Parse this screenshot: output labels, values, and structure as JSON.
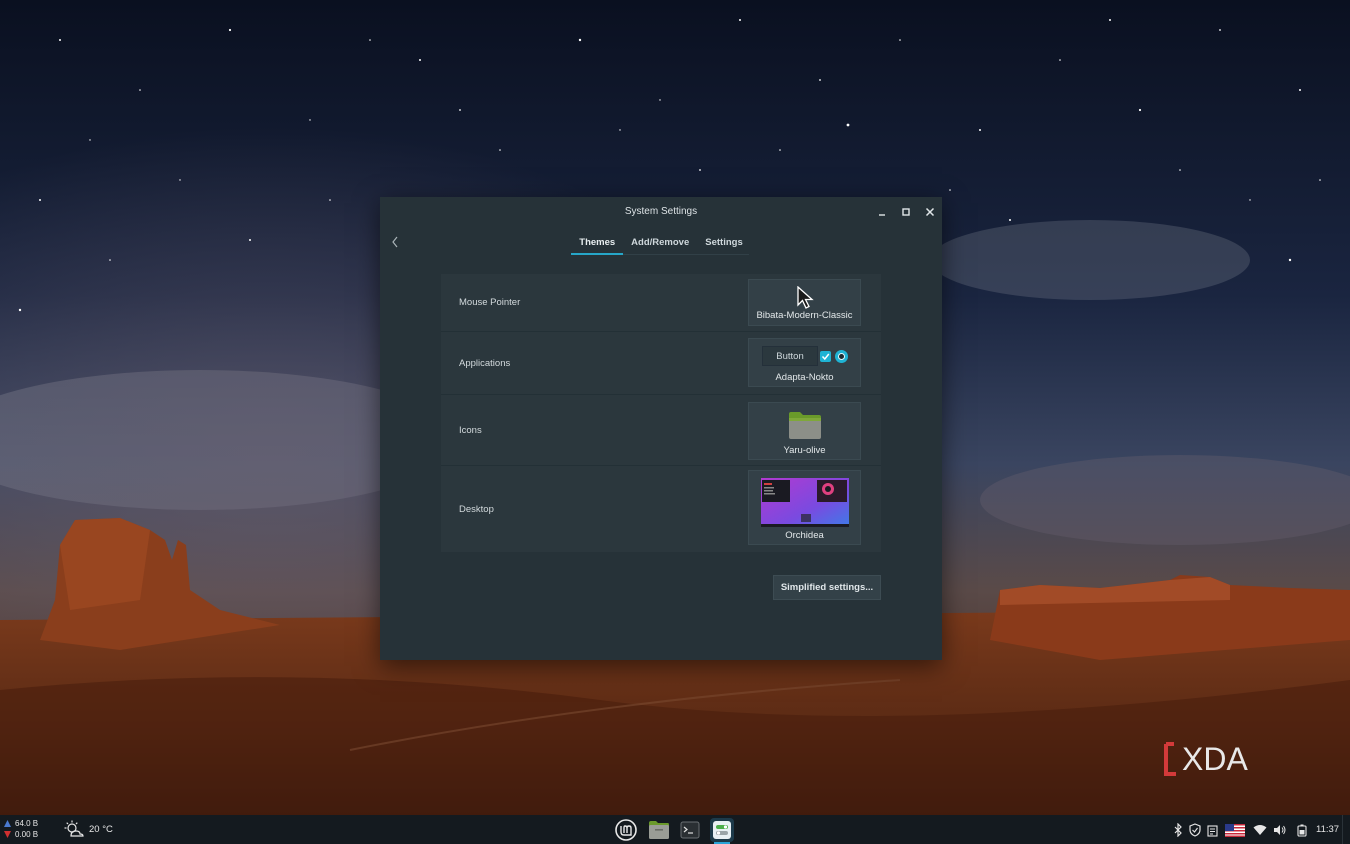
{
  "window": {
    "title": "System Settings",
    "tabs": [
      {
        "label": "Themes",
        "active": true
      },
      {
        "label": "Add/Remove",
        "active": false
      },
      {
        "label": "Settings",
        "active": false
      }
    ],
    "rows": [
      {
        "label": "Mouse Pointer",
        "value": "Bibata-Modern-Classic"
      },
      {
        "label": "Applications",
        "value": "Adapta-Nokto",
        "preview_button": "Button"
      },
      {
        "label": "Icons",
        "value": "Yaru-olive"
      },
      {
        "label": "Desktop",
        "value": "Orchidea"
      }
    ],
    "simplified_button": "Simplified settings..."
  },
  "taskbar": {
    "network": {
      "upload": "64.0 B",
      "download": "0.00 B"
    },
    "weather": "20 °C",
    "clock": "11:37",
    "launchers": [
      "mint-menu-icon",
      "files-icon",
      "terminal-icon",
      "system-settings-icon"
    ],
    "tray": [
      "bluetooth-icon",
      "shield-icon",
      "clipboard-icon",
      "us-flag-icon",
      "wifi-icon",
      "volume-icon",
      "battery-icon"
    ]
  },
  "watermark": "XDA",
  "colors": {
    "window_bg": "#263238",
    "accent": "#26a6c8",
    "taskbar_bg": "#141a1f"
  }
}
